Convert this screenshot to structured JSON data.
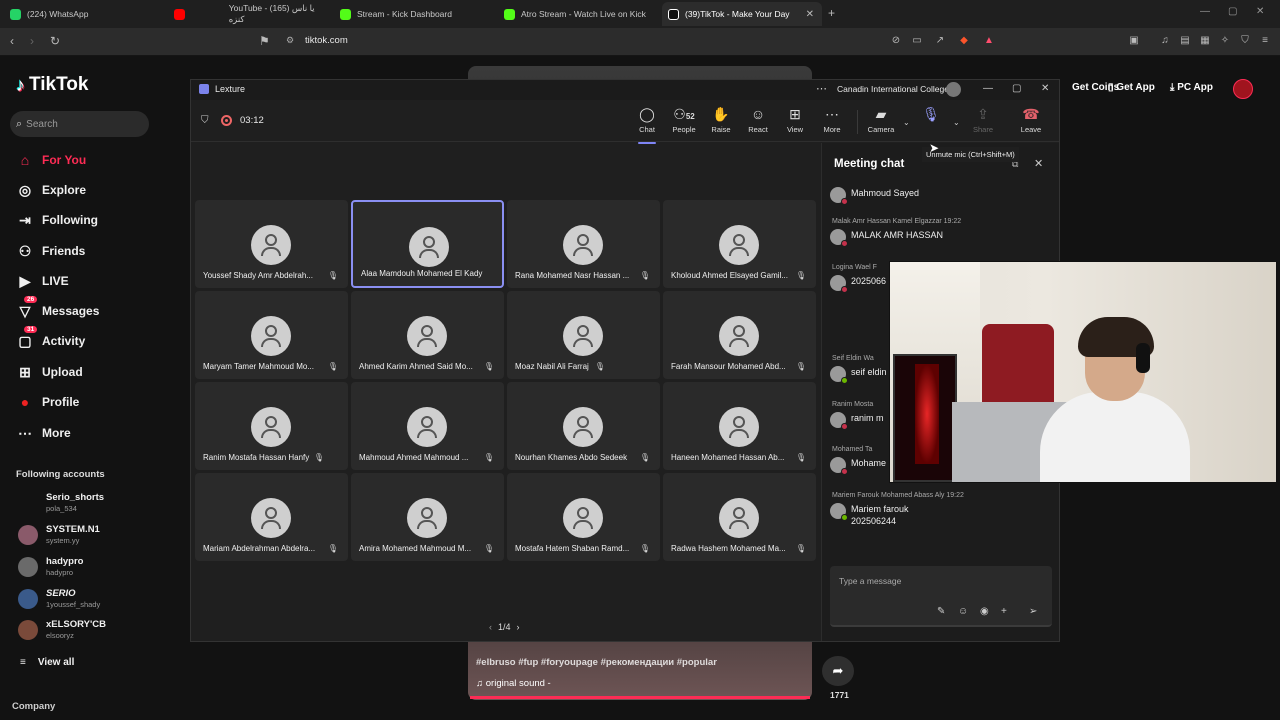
{
  "browser": {
    "tabs": [
      {
        "label": "(224) WhatsApp",
        "color": "#25d366"
      },
      {
        "label": "YouTube - (165) يا ناس كنزه",
        "color": "#ff0000"
      },
      {
        "label": "Stream - Kick Dashboard",
        "color": "#53fc18"
      },
      {
        "label": "Atro Stream - Watch Live on Kick",
        "color": "#53fc18"
      },
      {
        "label": "(39)TikTok - Make Your Day",
        "color": "#ffffff"
      }
    ],
    "url": "tiktok.com"
  },
  "tiktok": {
    "logo": "TikTok",
    "search_placeholder": "Search",
    "nav": [
      {
        "label": "For You",
        "icon": "home-icon"
      },
      {
        "label": "Explore",
        "icon": "compass-icon"
      },
      {
        "label": "Following",
        "icon": "following-icon"
      },
      {
        "label": "Friends",
        "icon": "friends-icon"
      },
      {
        "label": "LIVE",
        "icon": "live-icon"
      },
      {
        "label": "Messages",
        "icon": "messages-icon",
        "badge": "26"
      },
      {
        "label": "Activity",
        "icon": "activity-icon",
        "badge": "31"
      },
      {
        "label": "Upload",
        "icon": "upload-icon"
      },
      {
        "label": "Profile",
        "icon": "profile-icon"
      },
      {
        "label": "More",
        "icon": "more-icon"
      }
    ],
    "following_title": "Following accounts",
    "following": [
      {
        "name": "Serio_shorts",
        "handle": "pola_534"
      },
      {
        "name": "SYSTEM.N1",
        "handle": "system.yy"
      },
      {
        "name": "hadypro",
        "handle": "hadypro"
      },
      {
        "name": "SERIO",
        "handle": "1youssef_shady"
      },
      {
        "name": "xELSORY'CB",
        "handle": "elsooryz"
      }
    ],
    "view_all": "View all",
    "company": "Company",
    "top": {
      "get_coins": "Get Coins",
      "get_app": "Get App",
      "pc_app": "PC App"
    },
    "video": {
      "tags": "#elbruso #fup #foryoupage #рекомендации #popular",
      "sound": "original sound - ",
      "share_count": "1771"
    }
  },
  "teams": {
    "app_name": "Lexture",
    "org": "Canadin International College",
    "timer": "03:12",
    "toolbar": {
      "chat": "Chat",
      "people": "People",
      "people_count": "52",
      "raise": "Raise",
      "react": "React",
      "view": "View",
      "more": "More",
      "camera": "Camera",
      "share": "Share",
      "leave": "Leave"
    },
    "tooltip": "Unmute mic (Ctrl+Shift+M)",
    "participants": [
      "Youssef Shady Amr Abdelrah...",
      "Alaa Mamdouh Mohamed El Kady",
      "Rana Mohamed Nasr Hassan ...",
      "Kholoud Ahmed Elsayed Gamil...",
      "Maryam Tamer Mahmoud Mo...",
      "Ahmed Karim Ahmed Said Mo...",
      "Moaz Nabil Ali Farraj",
      "Farah Mansour Mohamed Abd...",
      "Ranim Mostafa Hassan Hanfy",
      "Mahmoud Ahmed Mahmoud ...",
      "Nourhan Khames Abdo Sedeek",
      "Haneen Mohamed Hassan Ab...",
      "Mariam Abdelrahman Abdelra...",
      "Amira Mohamed Mahmoud M...",
      "Mostafa Hatem Shaban Ramd...",
      "Radwa Hashem Mohamed Ma..."
    ],
    "pager": "1/4",
    "chat": {
      "title": "Meeting chat",
      "messages": [
        {
          "meta": "",
          "text": "Mahmoud Sayed"
        },
        {
          "meta": "Malak Amr Hassan Kamel Elgazzar  19:22",
          "text": "MALAK AMR HASSAN"
        },
        {
          "meta": "Logina Wael F",
          "text": "2025066"
        },
        {
          "meta": "Seif Eldin Wa",
          "text": "seif eldin"
        },
        {
          "meta": "Ranim Mosta",
          "text": "ranim m"
        },
        {
          "meta": "Mohamed Ta",
          "text": "Mohame"
        },
        {
          "meta": "Mariem Farouk Mohamed Abass Aly  19:22",
          "text": "Mariem farouk"
        }
      ],
      "last_extra": "202506244",
      "input_placeholder": "Type a message"
    }
  }
}
